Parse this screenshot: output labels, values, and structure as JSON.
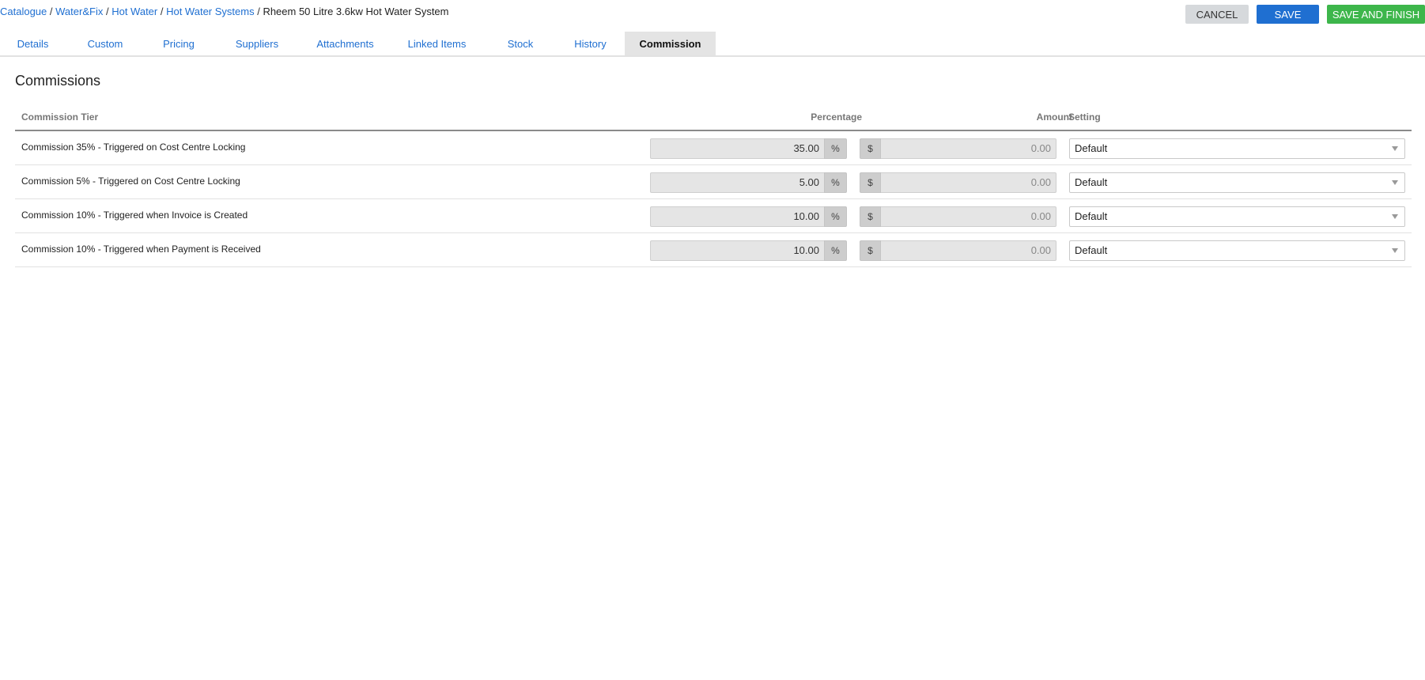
{
  "breadcrumb": {
    "items": [
      "Catalogue",
      "Water&Fix",
      "Hot Water",
      "Hot Water Systems"
    ],
    "current": "Rheem 50 Litre 3.6kw Hot Water System",
    "separator": "/"
  },
  "actions": {
    "cancel": "CANCEL",
    "save": "SAVE",
    "save_finish": "SAVE AND FINISH"
  },
  "tabs": [
    {
      "label": "Details"
    },
    {
      "label": "Custom"
    },
    {
      "label": "Pricing"
    },
    {
      "label": "Suppliers"
    },
    {
      "label": "Attachments"
    },
    {
      "label": "Linked Items"
    },
    {
      "label": "Stock"
    },
    {
      "label": "History"
    },
    {
      "label": "Commission",
      "active": true
    }
  ],
  "section": {
    "title": "Commissions"
  },
  "table": {
    "headers": {
      "tier": "Commission Tier",
      "percentage": "Percentage",
      "amount": "Amount",
      "setting": "Setting"
    },
    "percent_symbol": "%",
    "currency_symbol": "$",
    "rows": [
      {
        "tier": "Commission 35% - Triggered on Cost Centre Locking",
        "percentage": "35.00",
        "amount": "0.00",
        "setting": "Default"
      },
      {
        "tier": "Commission 5% - Triggered on Cost Centre Locking",
        "percentage": "5.00",
        "amount": "0.00",
        "setting": "Default"
      },
      {
        "tier": "Commission 10% - Triggered when Invoice is Created",
        "percentage": "10.00",
        "amount": "0.00",
        "setting": "Default"
      },
      {
        "tier": "Commission 10% - Triggered when Payment is Received",
        "percentage": "10.00",
        "amount": "0.00",
        "setting": "Default"
      }
    ]
  },
  "colors": {
    "link": "#1f6fd1",
    "save": "#1f6fd1",
    "save_finish": "#3db64b",
    "cancel": "#d6d9dc"
  }
}
